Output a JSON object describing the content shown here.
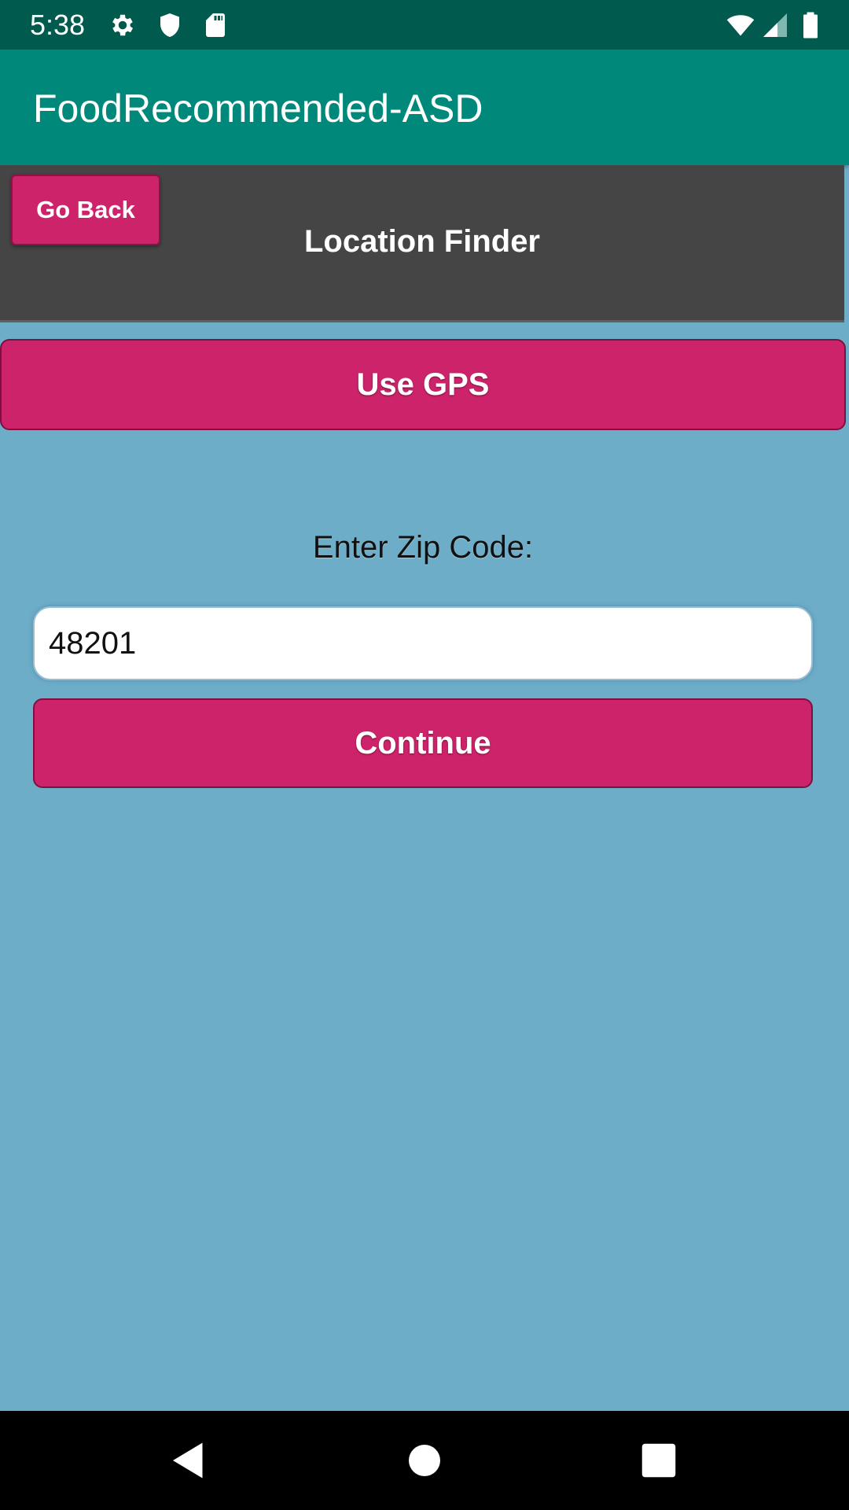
{
  "status_bar": {
    "time": "5:38",
    "icons": [
      "gear-icon",
      "shield-icon",
      "sd-card-icon",
      "wifi-icon",
      "cell-signal-icon",
      "battery-icon"
    ]
  },
  "app_bar": {
    "title": "FoodRecommended-ASD"
  },
  "header": {
    "title": "Location Finder",
    "go_back_label": "Go Back"
  },
  "main": {
    "gps_button_label": "Use GPS",
    "zip_label": "Enter Zip Code:",
    "zip_value": "48201",
    "continue_label": "Continue"
  },
  "nav_bar": {
    "icons": [
      "back-icon",
      "home-icon",
      "recents-icon"
    ]
  },
  "colors": {
    "status_bar": "#005A4E",
    "app_bar": "#00897B",
    "header_panel": "#454545",
    "background": "#6EADC7",
    "button": "#CD236B"
  }
}
